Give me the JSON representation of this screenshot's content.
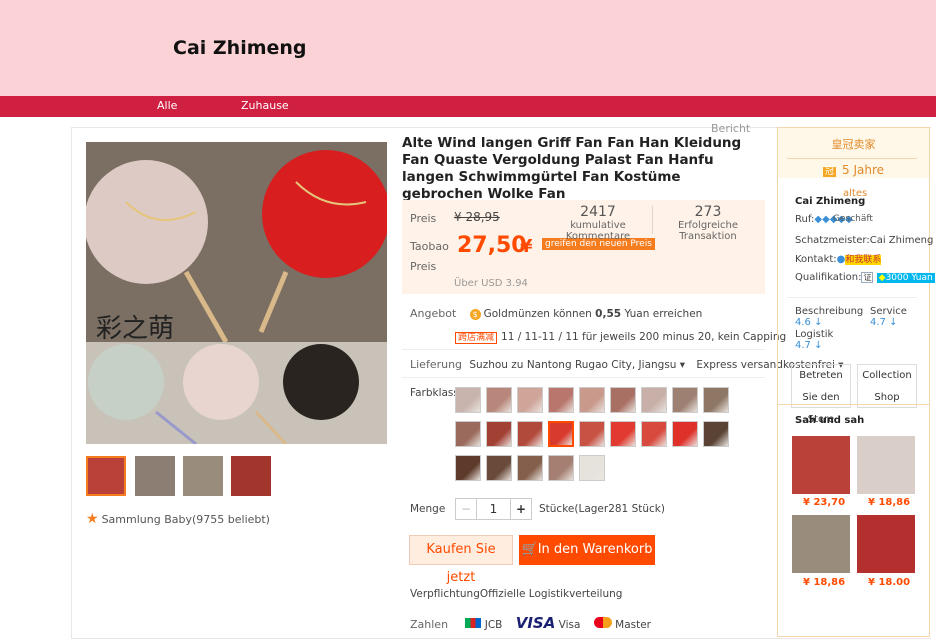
{
  "header": {
    "store_name": "Cai Zhimeng"
  },
  "nav": {
    "items": [
      "Alle",
      "Zuhause"
    ]
  },
  "report": "Bericht",
  "product": {
    "title": "Alte Wind langen Griff Fan Fan Han Kleidung Fan Quaste Vergoldung Palast Fan Hanfu langen Schwimmgürtel Fan Kostüme gebrochen Wolke Fan",
    "price_label": "Preis",
    "original_price": "¥ 28,95",
    "taobao_price_label": "Taobao Preis",
    "price": "27,50",
    "currency": "¥",
    "promo": "greifen den neuen Preis",
    "usd": "Über USD 3.94",
    "comments_count": "2417",
    "comments_label": "kumulative Kommentare",
    "transactions_count": "273",
    "transactions_label": "Erfolgreiche Transaktion",
    "offer_label": "Angebot",
    "coins_prefix": "Goldmünzen können",
    "coins_value": "0,55",
    "coins_suffix": "Yuan erreichen",
    "crossstore_tag": "跨店满减",
    "crossstore_text": "11 / 11-11 / 11 für jeweils 200 minus 20, kein Capping",
    "delivery_label": "Lieferung",
    "delivery_from": "Suzhou zu",
    "delivery_to": "Nantong Rugao City, Jiangsu",
    "delivery_type": "Express versandkostenfrei",
    "color_label": "Farbklassifizierung",
    "qty_label": "Menge",
    "qty_minus": "−",
    "qty_value": "1",
    "qty_plus": "+",
    "stock": "Stücke(Lager281 Stück)",
    "buy_label": "Kaufen Sie jetzt",
    "cart_icon": "cart-icon",
    "cart_label": "In   den Warenkorb",
    "commitment_label": "Verpflichtung",
    "commitment_text": "Offizielle Logistikverteilung",
    "pay_label": "Zahlen",
    "pay_jcb": "JCB",
    "pay_visa_logo": "VISA",
    "pay_visa": "Visa",
    "pay_master": "Master",
    "favorites": "Sammlung Baby(9755 beliebt)"
  },
  "seller": {
    "crown_label": "皇冠卖家",
    "years": "5 Jahre",
    "years_suffix": "altes",
    "name": "Cai Zhimeng",
    "fame_label": "Ruf:",
    "fame_icon": "diamond-icons",
    "fame_overlay": "Geschäft",
    "treasurer": "Schatzmeister:Cai Zhimeng",
    "contact_label": "Kontakt:",
    "contact_link": "和我联系",
    "qual_label": "Qualifikation:",
    "qual_badge": "3000 Yuan",
    "desc_label": "Beschreibung",
    "desc_score": "4.6",
    "service_label": "Service",
    "service_score": "4.7",
    "logistics_label": "Logistik",
    "logistics_score": "4.7",
    "enter_store": "Betreten Sie den Store",
    "collection_shop": "Collection Shop",
    "seen_title": "Sah und sah",
    "rec_prices": [
      "¥ 23,70",
      "¥ 18,86",
      "¥ 18,86",
      "¥ 18.00"
    ]
  },
  "colors": {
    "accent": "#cf2042",
    "header_bg": "#fbd2d5",
    "price": "#ff4a00"
  }
}
